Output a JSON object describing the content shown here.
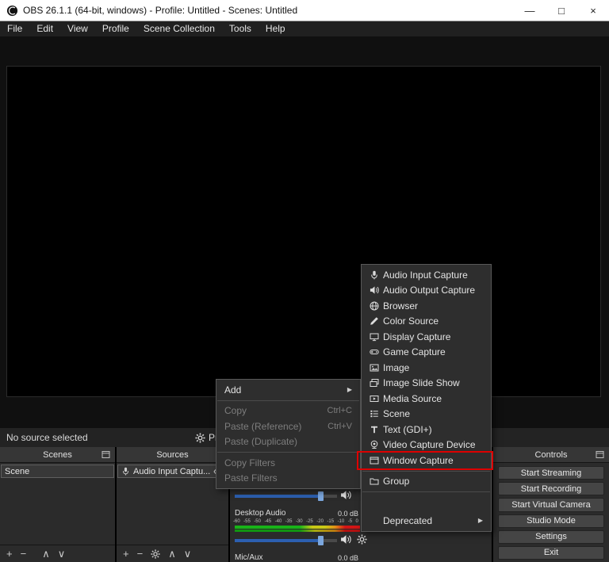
{
  "window": {
    "title": "OBS 26.1.1 (64-bit, windows) - Profile: Untitled - Scenes: Untitled",
    "controls": {
      "minimize": "—",
      "maximize": "□",
      "close": "×"
    }
  },
  "menubar": {
    "items": [
      "File",
      "Edit",
      "View",
      "Profile",
      "Scene Collection",
      "Tools",
      "Help"
    ]
  },
  "statusbar": {
    "no_source": "No source selected",
    "properties_label": "Pro"
  },
  "docks": {
    "scenes": {
      "title": "Scenes",
      "items": [
        "Scene"
      ]
    },
    "sources": {
      "title": "Sources",
      "items": [
        {
          "label": "Audio Input Captu...",
          "icon": "mic"
        }
      ]
    },
    "mixer": {
      "channels": [
        {
          "name": "Desktop Audio",
          "db": "0.0 dB"
        },
        {
          "name": "Mic/Aux",
          "db": "0.0 dB"
        }
      ],
      "scale": [
        "-60",
        "-55",
        "-50",
        "-45",
        "-40",
        "-35",
        "-30",
        "-25",
        "-20",
        "-15",
        "-10",
        "-5",
        "0"
      ]
    },
    "controls": {
      "title": "Controls",
      "buttons": [
        "Start Streaming",
        "Start Recording",
        "Start Virtual Camera",
        "Studio Mode",
        "Settings",
        "Exit"
      ]
    }
  },
  "context_menu": {
    "add": {
      "label": "Add"
    },
    "copy": {
      "label": "Copy",
      "shortcut": "Ctrl+C"
    },
    "paste_reference": {
      "label": "Paste (Reference)",
      "shortcut": "Ctrl+V"
    },
    "paste_duplicate": {
      "label": "Paste (Duplicate)"
    },
    "copy_filters": {
      "label": "Copy Filters"
    },
    "paste_filters": {
      "label": "Paste Filters"
    }
  },
  "add_submenu": {
    "items": [
      {
        "label": "Audio Input Capture",
        "icon": "mic"
      },
      {
        "label": "Audio Output Capture",
        "icon": "speaker"
      },
      {
        "label": "Browser",
        "icon": "globe"
      },
      {
        "label": "Color Source",
        "icon": "brush"
      },
      {
        "label": "Display Capture",
        "icon": "display"
      },
      {
        "label": "Game Capture",
        "icon": "gamepad"
      },
      {
        "label": "Image",
        "icon": "image"
      },
      {
        "label": "Image Slide Show",
        "icon": "slideshow"
      },
      {
        "label": "Media Source",
        "icon": "media"
      },
      {
        "label": "Scene",
        "icon": "scene-list"
      },
      {
        "label": "Text (GDI+)",
        "icon": "text"
      },
      {
        "label": "Video Capture Device",
        "icon": "camera"
      },
      {
        "label": "Window Capture",
        "icon": "window",
        "highlighted": true
      },
      {
        "label": "Group",
        "icon": "folder"
      },
      {
        "label": "Deprecated",
        "icon": "none",
        "submenu": true
      }
    ]
  },
  "icons": {
    "submenu_arrow": "▶",
    "plus": "+",
    "minus": "−",
    "up": "∧",
    "down": "∨"
  },
  "colors": {
    "accent_blue": "#2c5fb0",
    "slider_handle": "#7ba6dd",
    "annotation_red": "#dd0000",
    "meter_green": "#18b418",
    "meter_yellow": "#c9c916",
    "meter_red": "#d31515",
    "titlebar_bg": "#ffffff",
    "panel_bg": "#2b2b2b"
  }
}
